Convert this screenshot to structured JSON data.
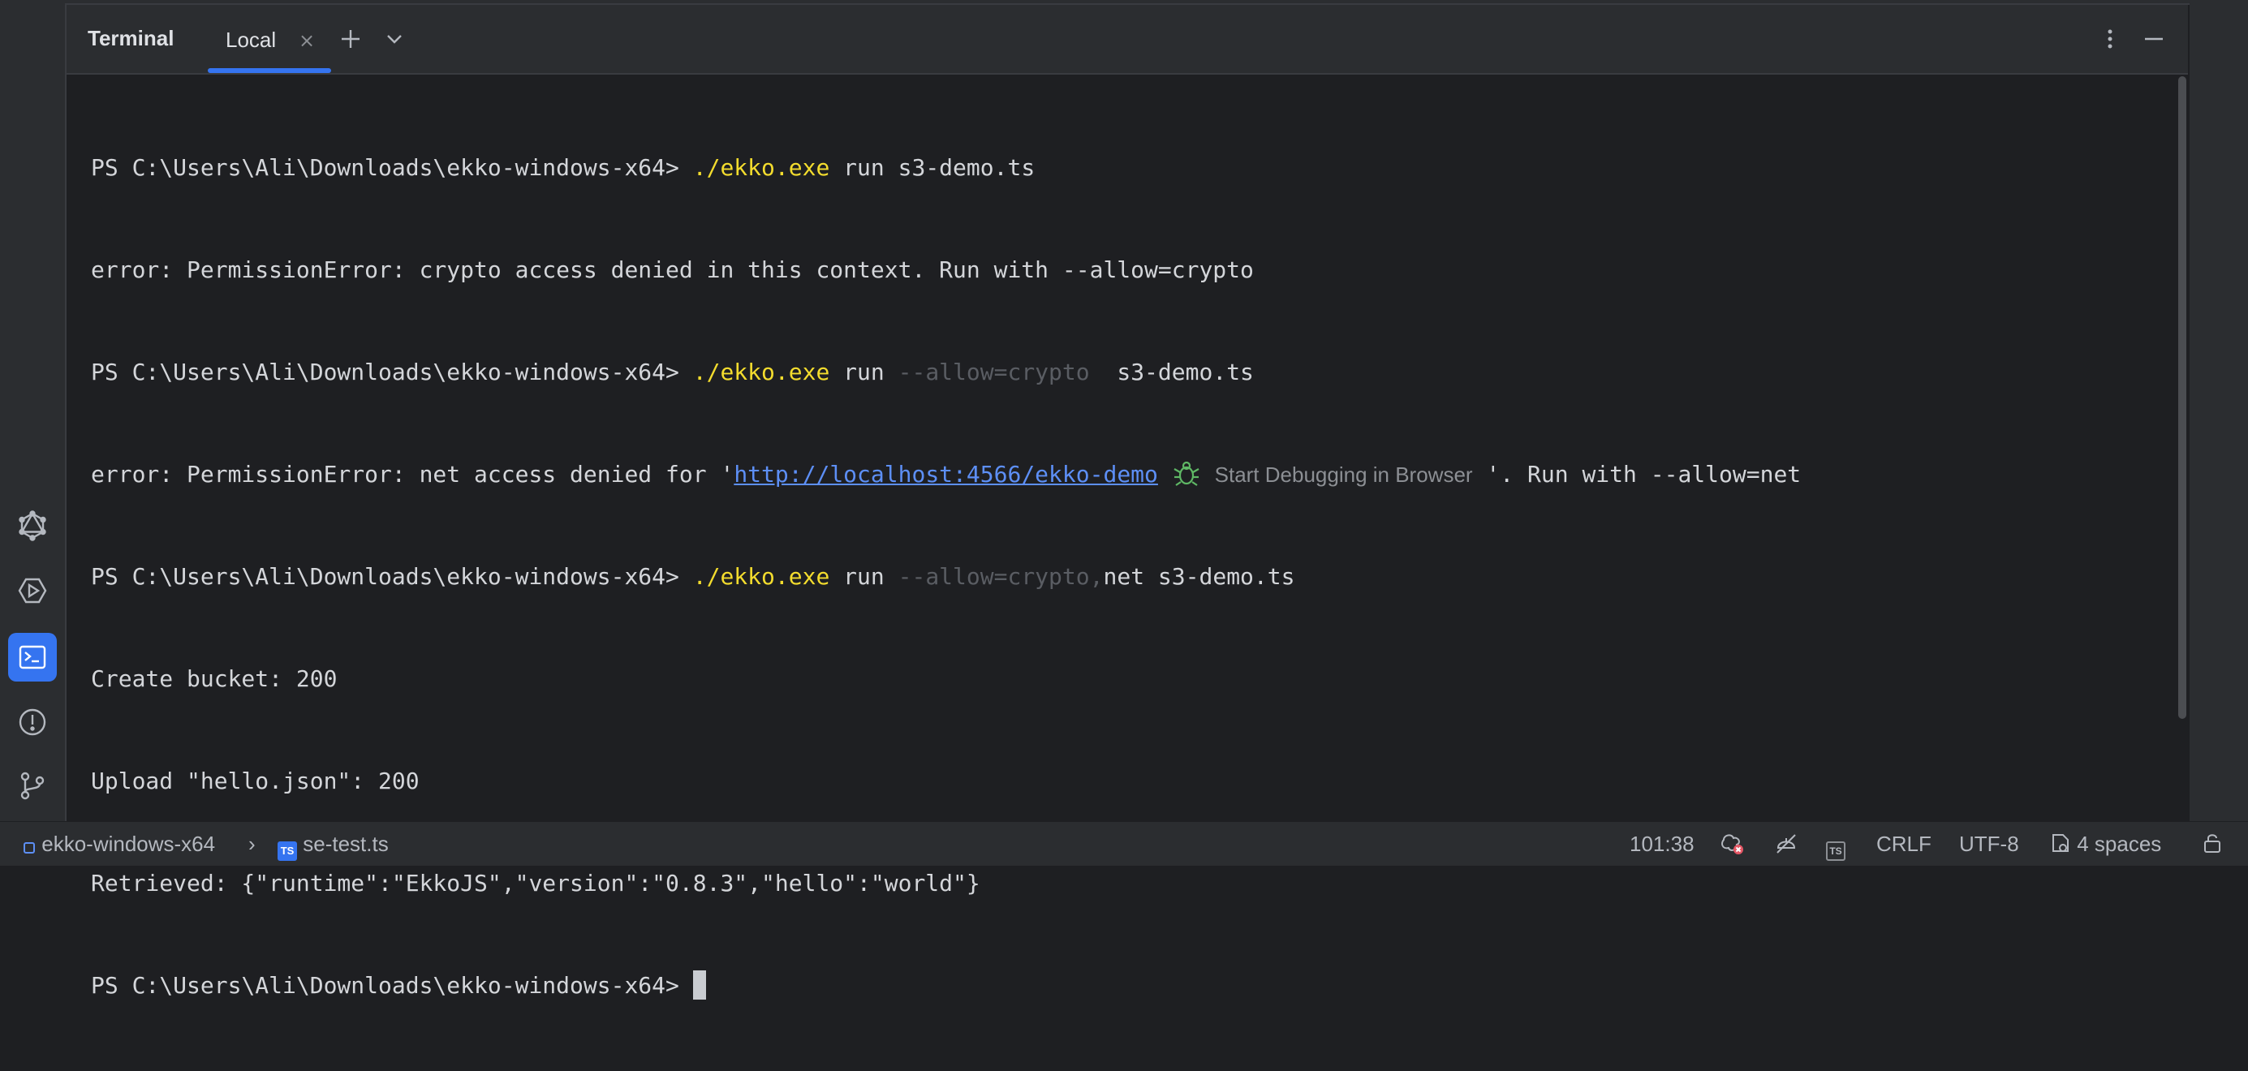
{
  "panel": {
    "title": "Terminal",
    "tab_label": "Local",
    "tab_close": "×",
    "new_tab": "+",
    "tab_dropdown": "chevron-down"
  },
  "terminal": {
    "prompt": "PS C:\\Users\\Ali\\Downloads\\ekko-windows-x64> ",
    "line1_cmd": "./ekko.exe",
    "line1_rest": " run s3-demo.ts",
    "line2": "error: PermissionError: crypto access denied in this context. Run with --allow=crypto",
    "line3_cmd": "./ekko.exe",
    "line3_run": " run ",
    "line3_dim": "--allow=crypto",
    "line3_rest": "  s3-demo.ts",
    "line4_pre": "error: PermissionError: net access denied for '",
    "line4_link": "http://localhost:4566/ekko-demo",
    "line4_hint": "Start Debugging in Browser",
    "line4_post": " '. Run with --allow=net",
    "line5_cmd": "./ekko.exe",
    "line5_run": " run ",
    "line5_dim": "--allow=crypto,",
    "line5_rest": "net s3-demo.ts",
    "line6": "Create bucket: 200",
    "line7": "Upload \"hello.json\": 200",
    "line8": "Retrieved: {\"runtime\":\"EkkoJS\",\"version\":\"0.8.3\",\"hello\":\"world\"}"
  },
  "status": {
    "project": "ekko-windows-x64",
    "separator": "›",
    "file_badge": "TS",
    "file": "se-test.ts",
    "position": "101:38",
    "line_ending": "CRLF",
    "encoding": "UTF-8",
    "indent": "4 spaces",
    "lang_badge": "TS"
  },
  "colors": {
    "accent": "#3574f0",
    "command": "#f3dc2e",
    "link": "#5d8ff6",
    "background": "#1e1f22"
  }
}
